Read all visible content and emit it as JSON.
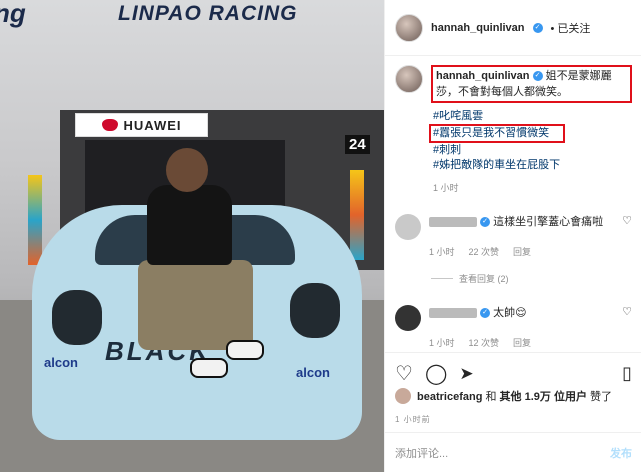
{
  "photo": {
    "banner_text": "LINPAO RACING",
    "banner_partial": "ng",
    "sponsor": "HUAWEI",
    "car_number": "24",
    "hood_text": "BLACK",
    "brand_left": "alcon",
    "brand_right": "alcon"
  },
  "header": {
    "username": "hannah_quinlivan",
    "follow_status": "• 已关注"
  },
  "caption": {
    "username": "hannah_quinlivan",
    "text": "姐不是蒙娜麗莎，不會對每個人都微笑。",
    "tags": [
      "#叱咤風雲",
      "#囂張只是我不習慣微笑",
      "#刺刺",
      "#姊把敵隊的車坐在屁股下"
    ],
    "time": "1 小时"
  },
  "comments": [
    {
      "username": "",
      "text": "這樣坐引擎蓋心會痛啦",
      "time": "1 小时",
      "likes": "22 次赞",
      "reply": "回复",
      "more_replies": "查看回复 (2)"
    },
    {
      "username": "",
      "text": "太帥😌",
      "time": "1 小时",
      "likes": "12 次赞",
      "reply": "回复"
    }
  ],
  "likes": {
    "user": "beatricefang",
    "connector": "和",
    "others": "其他 1.9万 位用户",
    "suffix": "赞了"
  },
  "date": "1 小时前",
  "comment_box": {
    "placeholder": "添加评论...",
    "post": "发布"
  },
  "icons": {
    "heart": "heart-icon",
    "comment": "comment-icon",
    "share": "share-icon",
    "bookmark": "bookmark-icon"
  },
  "colors": {
    "verified": "#3897f0",
    "highlight": "#e0101a",
    "hashtag": "#00376b",
    "post_disabled": "#b2dffc"
  }
}
